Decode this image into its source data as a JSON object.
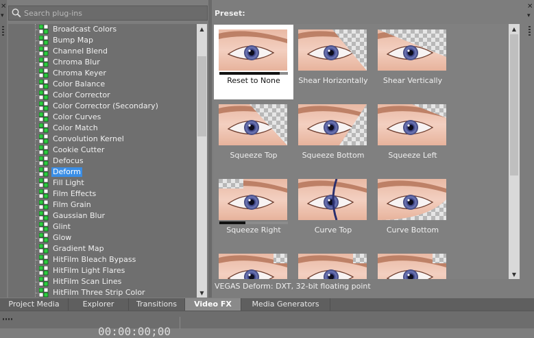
{
  "search": {
    "placeholder": "Search plug-ins"
  },
  "plugins": [
    "Broadcast Colors",
    "Bump Map",
    "Channel Blend",
    "Chroma Blur",
    "Chroma Keyer",
    "Color Balance",
    "Color Corrector",
    "Color Corrector (Secondary)",
    "Color Curves",
    "Color Match",
    "Convolution Kernel",
    "Cookie Cutter",
    "Defocus",
    "Deform",
    "Fill Light",
    "Film Effects",
    "Film Grain",
    "Gaussian Blur",
    "Glint",
    "Glow",
    "Gradient Map",
    "HitFilm Bleach Bypass",
    "HitFilm Light Flares",
    "HitFilm Scan Lines",
    "HitFilm Three Strip Color"
  ],
  "selected_plugin": "Deform",
  "preset_title": "Preset:",
  "presets": [
    {
      "label": "Reset to None",
      "selected": true,
      "variant": "none",
      "progress": 0.88
    },
    {
      "label": "Shear Horizontally",
      "selected": false,
      "variant": "shear-h"
    },
    {
      "label": "Shear Vertically",
      "selected": false,
      "variant": "shear-v"
    },
    {
      "label": "Squeeze Top",
      "selected": false,
      "variant": "sq-top"
    },
    {
      "label": "Squeeze Bottom",
      "selected": false,
      "variant": "sq-bottom"
    },
    {
      "label": "Squeeze Left",
      "selected": false,
      "variant": "sq-left"
    },
    {
      "label": "Squeeze Right",
      "selected": false,
      "variant": "sq-right",
      "progress": 0.38
    },
    {
      "label": "Curve Top",
      "selected": false,
      "variant": "curve-top"
    },
    {
      "label": "Curve Bottom",
      "selected": false,
      "variant": "curve-bottom"
    },
    {
      "label": "",
      "selected": false,
      "variant": "row4-a"
    },
    {
      "label": "",
      "selected": false,
      "variant": "row4-b"
    },
    {
      "label": "",
      "selected": false,
      "variant": "row4-c"
    }
  ],
  "status_text": "VEGAS Deform: DXT, 32-bit floating point",
  "tabs": [
    {
      "label": "Project Media",
      "active": false
    },
    {
      "label": "Explorer",
      "active": false
    },
    {
      "label": "Transitions",
      "active": false
    },
    {
      "label": "Video FX",
      "active": true
    },
    {
      "label": "Media Generators",
      "active": false
    }
  ],
  "timecode": "00:00:00;00",
  "colors": {
    "selection": "#3a8ee6",
    "panel": "#7d7d7d",
    "list_bg": "#6f6f6f",
    "fx_icon": "#2ecc40"
  }
}
